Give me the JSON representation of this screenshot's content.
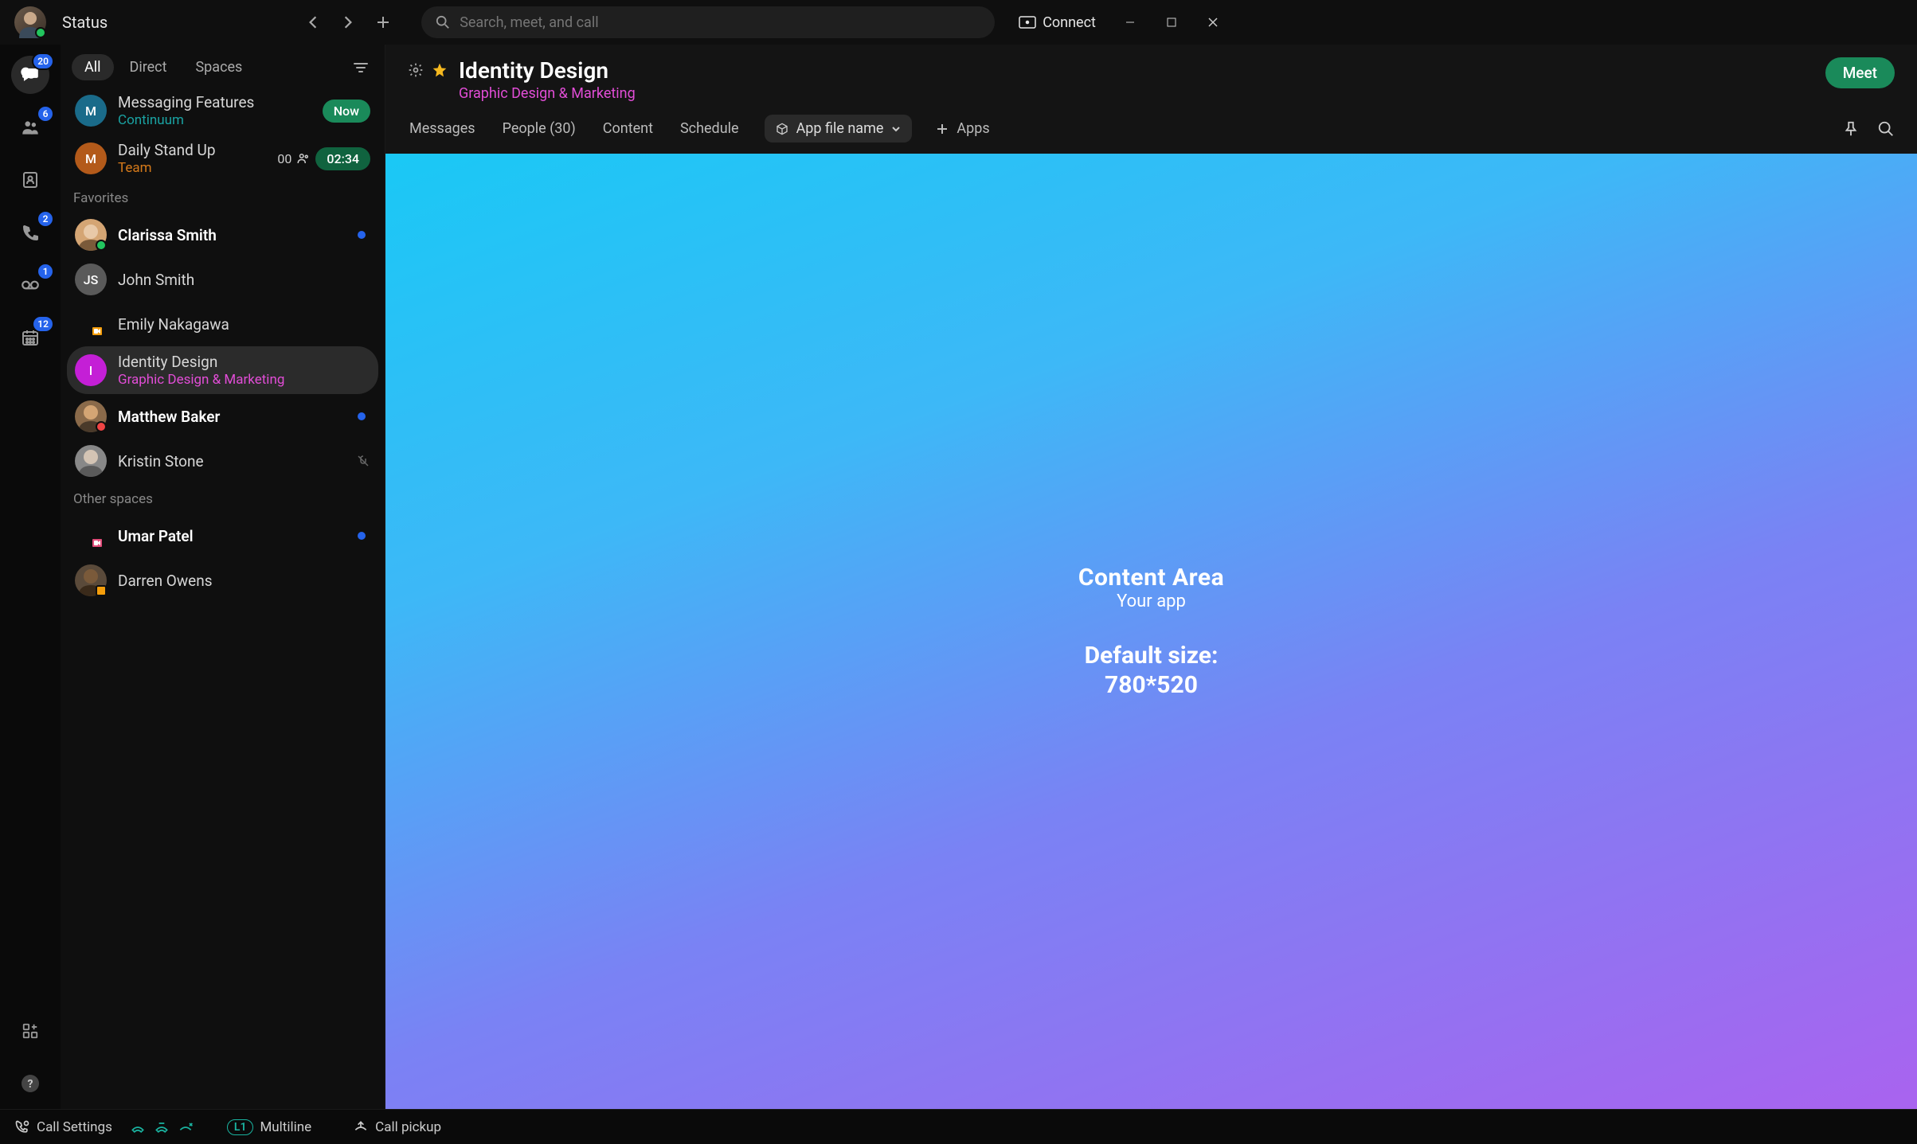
{
  "titlebar": {
    "status_label": "Status",
    "search_placeholder": "Search, meet, and call",
    "connect_label": "Connect"
  },
  "rail": {
    "items": [
      {
        "name": "chat",
        "badge": "20",
        "active": true
      },
      {
        "name": "teams",
        "badge": "6"
      },
      {
        "name": "contacts",
        "badge": ""
      },
      {
        "name": "calls",
        "badge": "2"
      },
      {
        "name": "voicemail",
        "badge": "1"
      },
      {
        "name": "calendar",
        "badge": "12"
      }
    ]
  },
  "list": {
    "tabs": {
      "all": "All",
      "direct": "Direct",
      "spaces": "Spaces"
    },
    "sections": {
      "favorites": "Favorites",
      "other_spaces": "Other spaces"
    },
    "top_items": [
      {
        "avatar_letter": "M",
        "avatar_color": "#1a6b8a",
        "title": "Messaging Features",
        "sub": "Continuum",
        "sub_color": "#1aa3a3",
        "pill": "Now"
      },
      {
        "avatar_letter": "M",
        "avatar_color": "#b35a1a",
        "title": "Daily Stand Up",
        "sub": "Team",
        "sub_color": "#d67a1a",
        "icon_text": "00",
        "pill": "02:34"
      }
    ],
    "favorites": [
      {
        "type": "photo",
        "photo": "clarissa",
        "presence": "green",
        "title": "Clarissa Smith",
        "bold": true,
        "unread": true
      },
      {
        "type": "initials",
        "initials": "JS",
        "bg": "#5a5a5a",
        "title": "John Smith"
      },
      {
        "type": "none",
        "camera": true,
        "title": "Emily Nakagawa"
      },
      {
        "type": "initials",
        "initials": "I",
        "bg": "#c41fd6",
        "title": "Identity Design",
        "sub": "Graphic Design & Marketing",
        "sub_color": "#e14dd6",
        "selected": true
      },
      {
        "type": "photo",
        "photo": "matthew",
        "presence": "red",
        "title": "Matthew Baker",
        "bold": true,
        "unread": true
      },
      {
        "type": "photo",
        "photo": "kristin",
        "title": "Kristin Stone",
        "muted": true
      }
    ],
    "other": [
      {
        "type": "none",
        "camera": true,
        "title": "Umar Patel",
        "bold": true,
        "unread": true
      },
      {
        "type": "photo",
        "photo": "darren",
        "presence": "orange",
        "title": "Darren Owens"
      }
    ]
  },
  "content": {
    "title": "Identity Design",
    "subtitle": "Graphic Design & Marketing",
    "meet": "Meet",
    "tabs": {
      "messages": "Messages",
      "people": "People (30)",
      "content": "Content",
      "schedule": "Schedule",
      "app_file": "App file name",
      "apps": "Apps"
    },
    "area": {
      "line1": "Content Area",
      "line2": "Your app",
      "line3": "Default size:",
      "line4": "780*520"
    }
  },
  "footer": {
    "call_settings": "Call Settings",
    "multiline_badge": "L1",
    "multiline_label": "Multiline",
    "call_pickup": "Call pickup"
  }
}
